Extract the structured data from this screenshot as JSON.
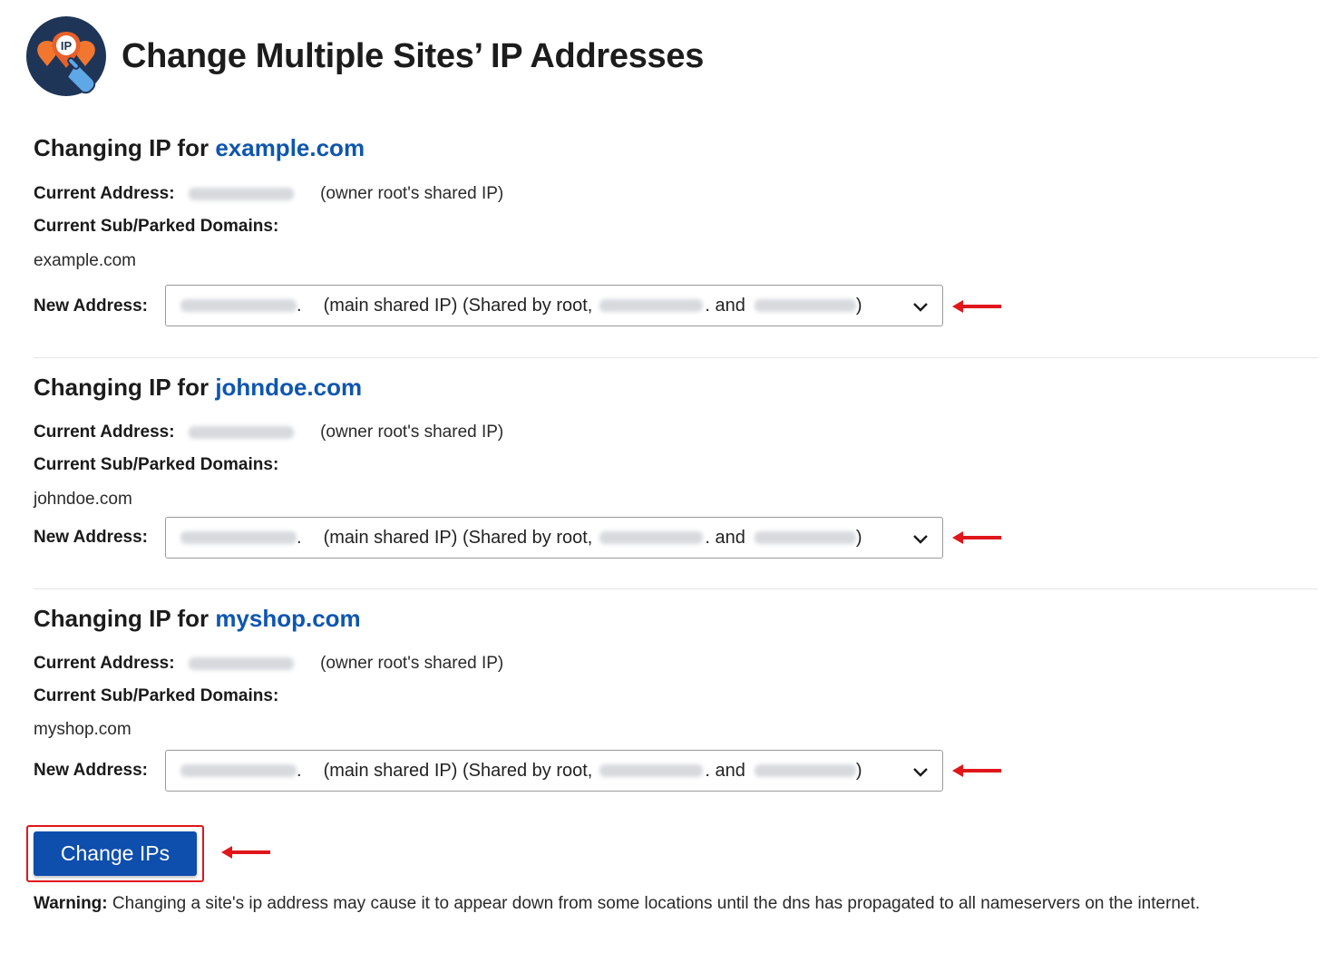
{
  "header": {
    "title": "Change Multiple Sites’ IP Addresses",
    "logo_text": "IP"
  },
  "labels": {
    "changing_prefix": "Changing IP for",
    "current_address": "Current Address:",
    "owner_note": "(owner root's shared IP)",
    "subparked": "Current Sub/Parked Domains:",
    "new_address": "New Address:",
    "option_dot": ".",
    "option_main": "(main shared IP) (Shared by root,",
    "option_and": ". and",
    "option_close": ")"
  },
  "sites": [
    {
      "domain": "example.com",
      "subdomain": "example.com"
    },
    {
      "domain": "johndoe.com",
      "subdomain": "johndoe.com"
    },
    {
      "domain": "myshop.com",
      "subdomain": "myshop.com"
    }
  ],
  "button": {
    "label": "Change IPs"
  },
  "warning": {
    "label": "Warning:",
    "text": "Changing a site's ip address may cause it to appear down from some locations until the dns has propagated to all nameservers on the internet."
  },
  "colors": {
    "link": "#0e56b0",
    "button": "#0e4ead",
    "annotation": "#e0161b"
  },
  "icons": {
    "dropdown": "chevron-down-icon",
    "annotation": "red-arrow-left-icon"
  }
}
